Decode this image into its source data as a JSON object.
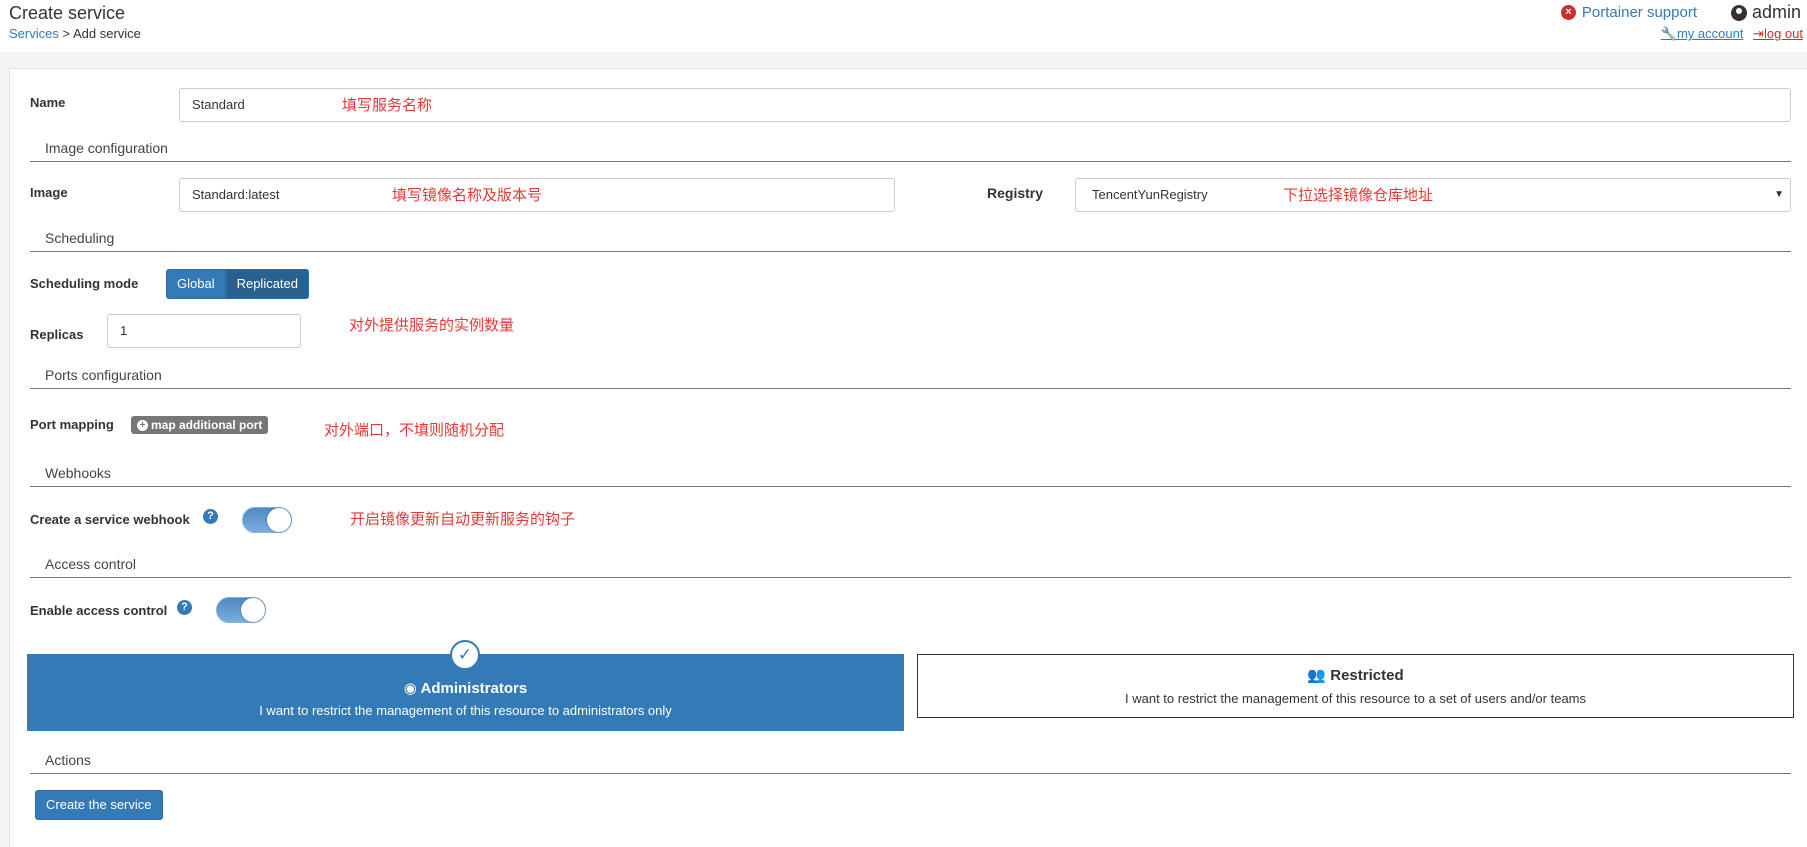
{
  "header": {
    "title": "Create service",
    "breadcrumb_link": "Services",
    "breadcrumb_sep": " > ",
    "breadcrumb_current": "Add service",
    "support_label": "Portainer support",
    "username": "admin",
    "my_account": "my account",
    "log_out": "log out"
  },
  "form": {
    "name_label": "Name",
    "name_value": "Standard",
    "name_note": "填写服务名称",
    "image_section": "Image configuration",
    "image_label": "Image",
    "image_value": "Standard:latest",
    "image_note": "填写镜像名称及版本号",
    "registry_label": "Registry",
    "registry_value": "TencentYunRegistry",
    "registry_note": "下拉选择镜像仓库地址",
    "scheduling_section": "Scheduling",
    "scheduling_mode_label": "Scheduling mode",
    "mode_global": "Global",
    "mode_replicated": "Replicated",
    "replicas_label": "Replicas",
    "replicas_value": "1",
    "replicas_note": "对外提供服务的实例数量",
    "ports_section": "Ports configuration",
    "port_mapping_label": "Port mapping",
    "map_port_button": "map additional port",
    "port_note": "对外端口，不填则随机分配",
    "webhooks_section": "Webhooks",
    "webhook_label": "Create a service webhook",
    "webhook_enabled": true,
    "webhook_note": "开启镜像更新自动更新服务的钩子",
    "access_section": "Access control",
    "access_label": "Enable access control",
    "access_enabled": true,
    "admin_title": "Administrators",
    "admin_desc": "I want to restrict the management of this resource to administrators only",
    "restricted_title": "Restricted",
    "restricted_desc": "I want to restrict the management of this resource to a set of users and/or teams",
    "actions_section": "Actions",
    "create_button": "Create the service"
  },
  "colors": {
    "primary": "#337ab7",
    "note_red": "#e53935",
    "danger": "#c9302c"
  }
}
